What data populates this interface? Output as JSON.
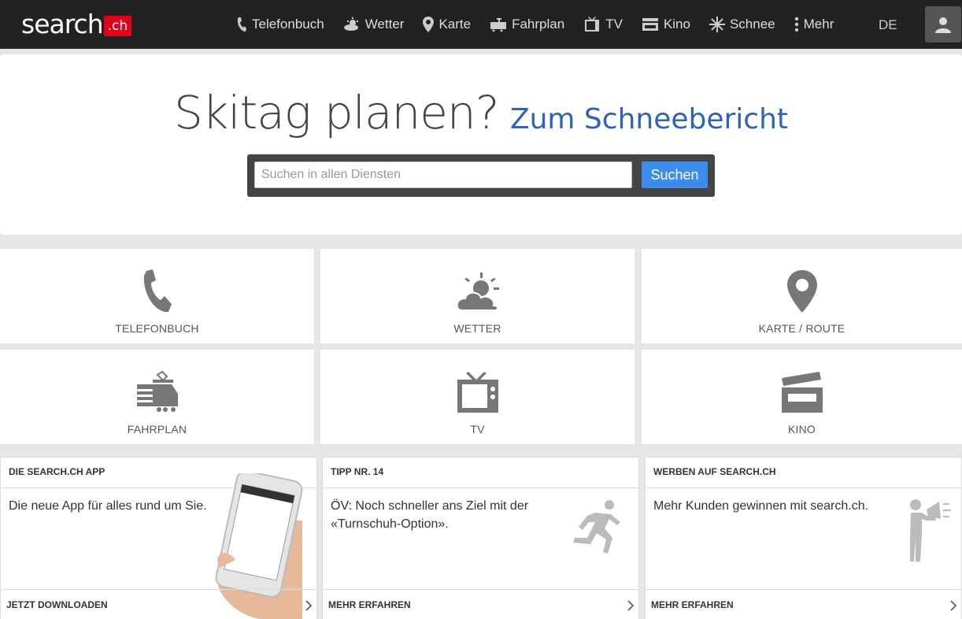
{
  "header": {
    "logo_text": "search",
    "logo_ch": ".ch",
    "nav": [
      {
        "label": "Telefonbuch",
        "icon": "phone-icon"
      },
      {
        "label": "Wetter",
        "icon": "weather-icon"
      },
      {
        "label": "Karte",
        "icon": "map-pin-icon"
      },
      {
        "label": "Fahrplan",
        "icon": "train-icon"
      },
      {
        "label": "TV",
        "icon": "tv-icon"
      },
      {
        "label": "Kino",
        "icon": "cinema-icon"
      },
      {
        "label": "Schnee",
        "icon": "snowflake-icon"
      },
      {
        "label": "Mehr",
        "icon": "more-icon"
      }
    ],
    "language": "DE",
    "user_icon": "user-icon"
  },
  "hero": {
    "title": "Skitag planen?",
    "link": "Zum Schneebericht",
    "search_placeholder": "Suchen in allen Diensten",
    "search_button": "Suchen"
  },
  "tiles": [
    {
      "label": "TELEFONBUCH",
      "icon": "phone-icon"
    },
    {
      "label": "WETTER",
      "icon": "weather-icon"
    },
    {
      "label": "KARTE / ROUTE",
      "icon": "map-pin-icon"
    },
    {
      "label": "FAHRPLAN",
      "icon": "train-icon"
    },
    {
      "label": "TV",
      "icon": "tv-icon"
    },
    {
      "label": "KINO",
      "icon": "cinema-icon"
    }
  ],
  "cards": [
    {
      "title": "DIE SEARCH.CH APP",
      "text": "Die neue App für alles rund um Sie.",
      "footer": "JETZT DOWNLOADEN",
      "image": "phone-in-hand-illustration"
    },
    {
      "title": "TIPP NR. 14",
      "text": "ÖV: Noch schneller ans Ziel mit der «Turnschuh-Option».",
      "footer": "MEHR ERFAHREN",
      "image": "running-man-icon"
    },
    {
      "title": "WERBEN AUF SEARCH.CH",
      "text": "Mehr Kunden gewinnen mit search.ch.",
      "footer": "MEHR ERFAHREN",
      "image": "megaphone-man-icon"
    }
  ],
  "colors": {
    "header_bg": "#222222",
    "brand_red": "#e2001a",
    "link_blue": "#2f63b8",
    "button_blue": "#3b8ced"
  }
}
